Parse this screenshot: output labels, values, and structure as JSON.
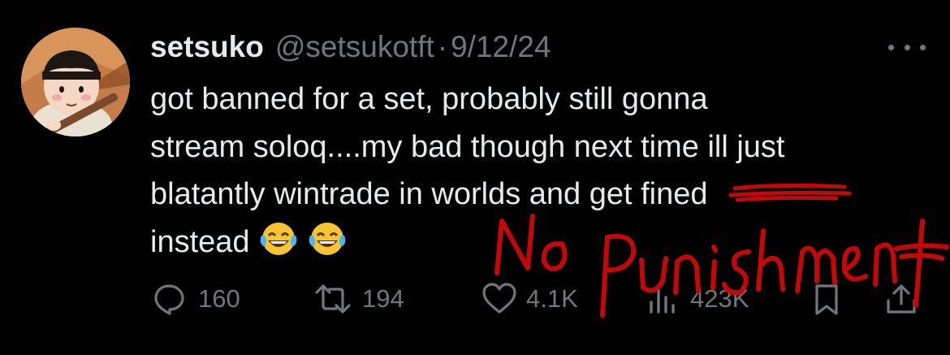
{
  "tweet": {
    "display_name": "setsuko",
    "handle": "@setsukotft",
    "separator": "·",
    "date": "9/12/24",
    "text_lines": [
      "got banned for a set, probably still gonna",
      "stream soloq....my bad though next time ill just",
      "blatantly wintrade in worlds and get ",
      "instead"
    ],
    "struck_word": "fined",
    "emojis": [
      "😂",
      "😂"
    ]
  },
  "actions": {
    "replies": "160",
    "retweets": "194",
    "likes": "4.1K",
    "views": "423K"
  },
  "annotation": {
    "handwritten_text": "No Punishment",
    "color": "#c40808"
  },
  "colors": {
    "background": "#000000",
    "text": "#e7e9ea",
    "muted": "#71767b"
  },
  "icons": [
    "more-icon",
    "reply-icon",
    "retweet-icon",
    "like-icon",
    "views-icon",
    "bookmark-icon",
    "share-icon"
  ]
}
